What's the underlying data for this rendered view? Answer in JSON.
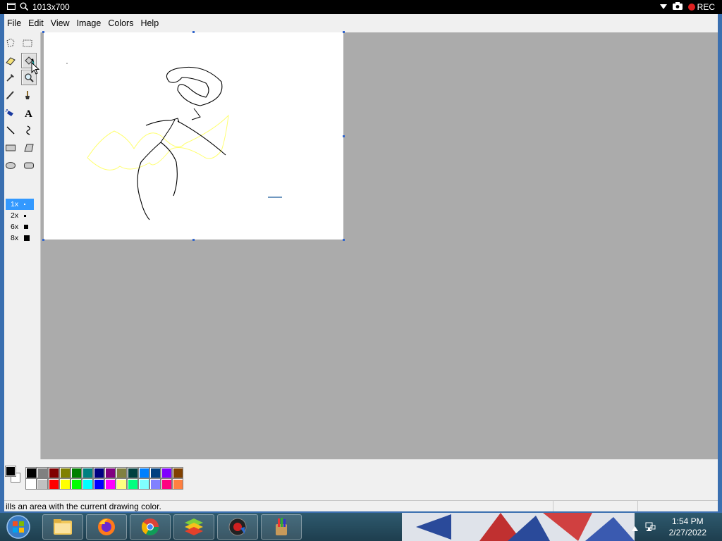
{
  "recorder": {
    "resolution": "1013x700",
    "rec_label": "REC"
  },
  "menu": [
    "File",
    "Edit",
    "View",
    "Image",
    "Colors",
    "Help"
  ],
  "tools": [
    {
      "name": "free-form-select",
      "icon": "free-select-icon"
    },
    {
      "name": "select",
      "icon": "rect-select-icon"
    },
    {
      "name": "eraser",
      "icon": "eraser-icon"
    },
    {
      "name": "fill-with-color",
      "icon": "paint-bucket-icon",
      "active": true
    },
    {
      "name": "pick-color",
      "icon": "eyedropper-icon"
    },
    {
      "name": "magnifier",
      "icon": "magnifier-icon",
      "active": true
    },
    {
      "name": "pencil",
      "icon": "pencil-icon"
    },
    {
      "name": "brush",
      "icon": "brush-icon"
    },
    {
      "name": "airbrush",
      "icon": "airbrush-icon"
    },
    {
      "name": "text",
      "icon": "text-icon"
    },
    {
      "name": "line",
      "icon": "line-icon"
    },
    {
      "name": "curve",
      "icon": "curve-icon"
    },
    {
      "name": "rectangle",
      "icon": "rectangle-icon"
    },
    {
      "name": "polygon",
      "icon": "polygon-icon"
    },
    {
      "name": "ellipse",
      "icon": "ellipse-icon"
    },
    {
      "name": "rounded-rectangle",
      "icon": "rounded-rect-icon"
    }
  ],
  "sizes": [
    {
      "label": "1x",
      "selected": true
    },
    {
      "label": "2x",
      "selected": false
    },
    {
      "label": "6x",
      "selected": false
    },
    {
      "label": "8x",
      "selected": false
    }
  ],
  "colors": {
    "foreground": "#000000",
    "background": "#ffffff",
    "palette_row1": [
      "#000000",
      "#808080",
      "#800000",
      "#808000",
      "#008000",
      "#008080",
      "#000080",
      "#800080",
      "#808040",
      "#004040",
      "#0080ff",
      "#004080",
      "#8000ff",
      "#804000"
    ],
    "palette_row2": [
      "#ffffff",
      "#c0c0c0",
      "#ff0000",
      "#ffff00",
      "#00ff00",
      "#00ffff",
      "#0000ff",
      "#ff00ff",
      "#ffff80",
      "#00ff80",
      "#80ffff",
      "#8080ff",
      "#ff0080",
      "#ff8040"
    ]
  },
  "status": {
    "text": "ills an area with the current drawing color."
  },
  "taskbar": {
    "apps": [
      {
        "name": "explorer",
        "icon": "folder-icon"
      },
      {
        "name": "firefox",
        "icon": "firefox-icon"
      },
      {
        "name": "chrome",
        "icon": "chrome-icon"
      },
      {
        "name": "bluestacks",
        "icon": "bluestacks-icon"
      },
      {
        "name": "recorder",
        "icon": "recorder-icon"
      },
      {
        "name": "paint",
        "icon": "paint-icon"
      }
    ],
    "time": "1:54 PM",
    "date": "2/27/2022"
  }
}
